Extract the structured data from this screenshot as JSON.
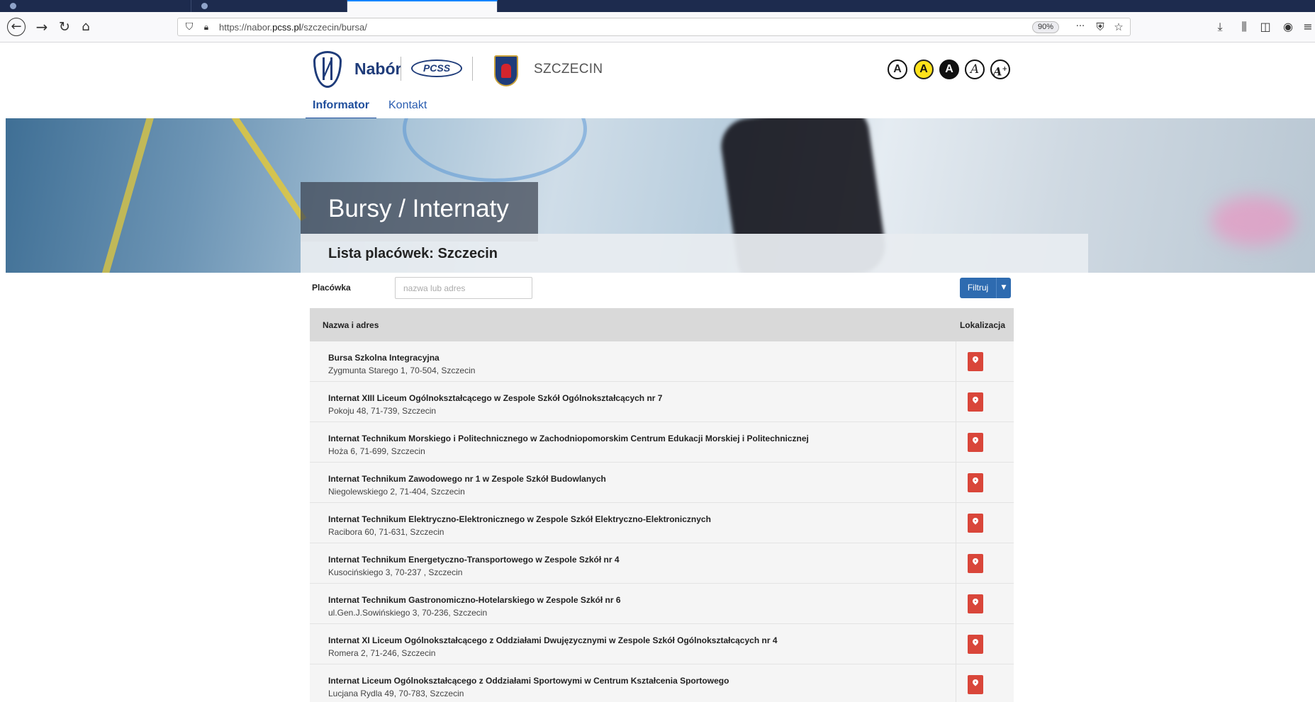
{
  "browser": {
    "url_prefix": "https://nabor.",
    "url_domain": "pcss.pl",
    "url_path": "/szczecin/bursa/",
    "zoom": "90%",
    "more_icon": "···"
  },
  "header": {
    "brand": "Nabór",
    "pcss_logo": "PCSS",
    "city": "SZCZECIN",
    "a11y": [
      "A",
      "A",
      "A",
      "A",
      "A"
    ],
    "a11y_plus": "+"
  },
  "nav": {
    "tabs": [
      {
        "label": "Informator",
        "active": true
      },
      {
        "label": "Kontakt",
        "active": false
      }
    ]
  },
  "hero": {
    "title": "Bursy / Internaty",
    "subtitle": "Lista placówek: Szczecin"
  },
  "filter": {
    "label": "Placówka",
    "placeholder": "nazwa lub adres",
    "button": "Filtruj"
  },
  "table": {
    "col_name": "Nazwa i adres",
    "col_loc": "Lokalizacja",
    "rows": [
      {
        "name": "Bursa Szkolna Integracyjna",
        "address": "Zygmunta Starego 1, 70-504, Szczecin"
      },
      {
        "name": "Internat XIII Liceum Ogólnokształcącego w Zespole Szkół Ogólnokształcących nr 7",
        "address": "Pokoju 48, 71-739, Szczecin"
      },
      {
        "name": "Internat Technikum Morskiego i Politechnicznego w Zachodniopomorskim Centrum Edukacji Morskiej i Politechnicznej",
        "address": "Hoża 6, 71-699, Szczecin"
      },
      {
        "name": "Internat Technikum Zawodowego nr 1 w Zespole Szkół Budowlanych",
        "address": "Niegolewskiego 2, 71-404, Szczecin"
      },
      {
        "name": "Internat Technikum Elektryczno-Elektronicznego w Zespole Szkół Elektryczno-Elektronicznych",
        "address": "Racibora 60, 71-631, Szczecin"
      },
      {
        "name": "Internat Technikum Energetyczno-Transportowego w Zespole Szkół nr 4",
        "address": "Kusocińskiego 3, 70-237 , Szczecin"
      },
      {
        "name": "Internat Technikum Gastronomiczno-Hotelarskiego w Zespole Szkół nr 6",
        "address": "ul.Gen.J.Sowińskiego 3, 70-236, Szczecin"
      },
      {
        "name": "Internat XI Liceum Ogólnokształcącego z Oddziałami Dwujęzycznymi w Zespole Szkół Ogólnokształcących nr 4",
        "address": "Romera 2, 71-246, Szczecin"
      },
      {
        "name": "Internat Liceum Ogólnokształcącego z Oddziałami Sportowymi w Centrum Kształcenia Sportowego",
        "address": "Lucjana Rydla 49, 70-783, Szczecin"
      }
    ]
  }
}
